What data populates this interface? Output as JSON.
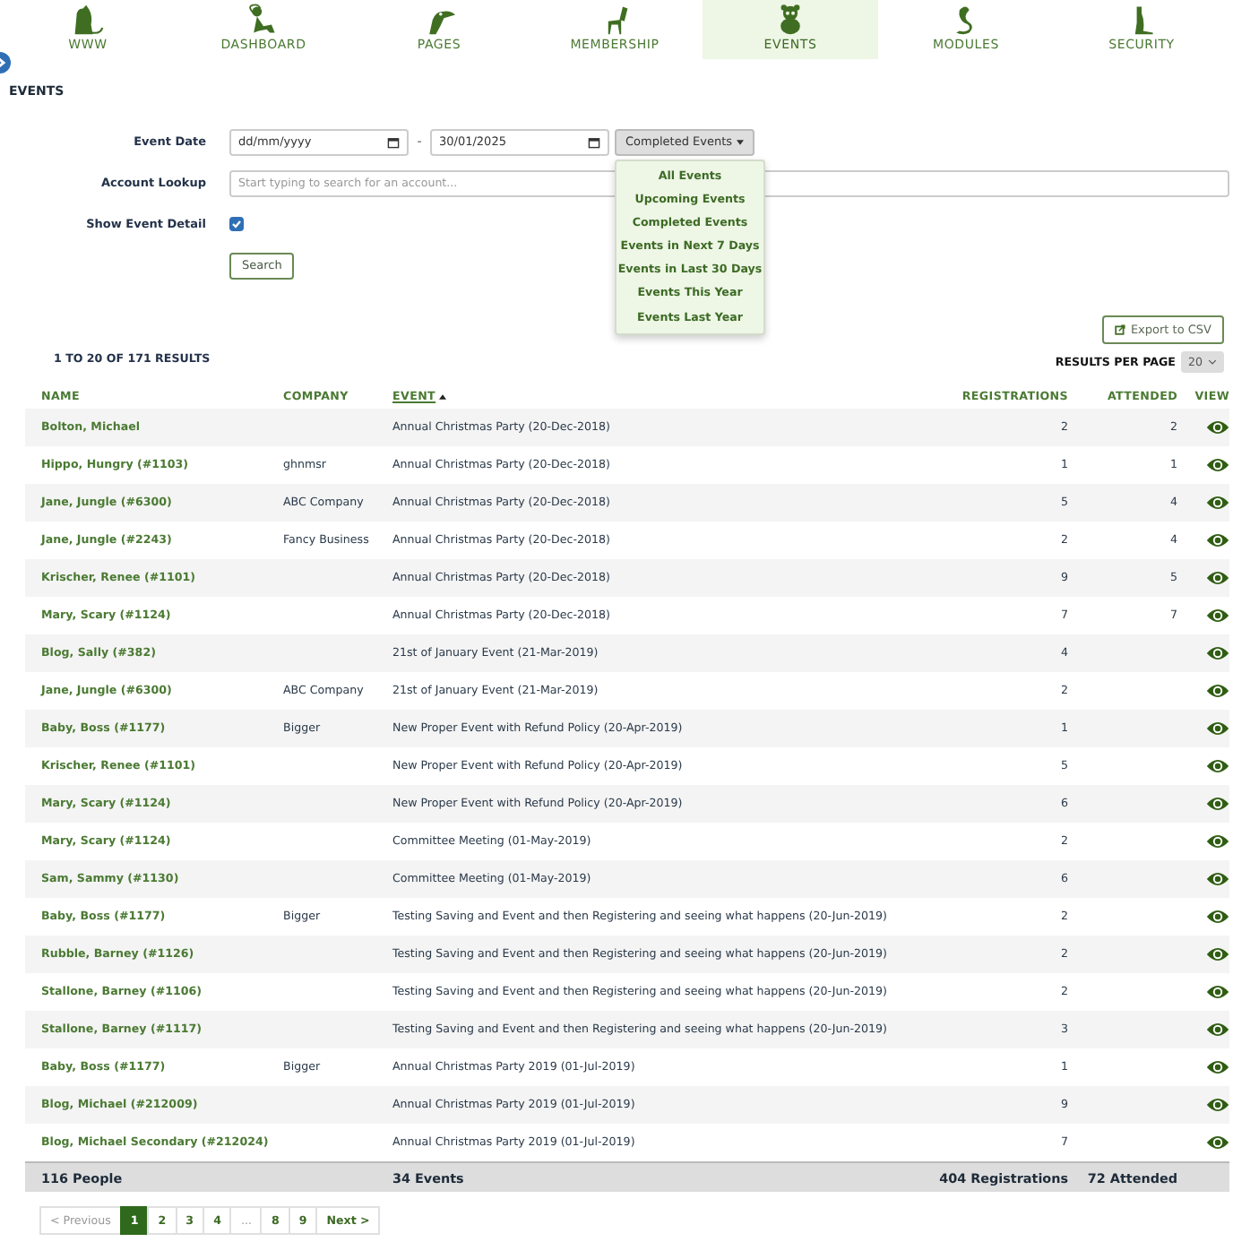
{
  "nav": [
    {
      "label": "WWW",
      "selected": false
    },
    {
      "label": "DASHBOARD",
      "selected": false
    },
    {
      "label": "PAGES",
      "selected": false
    },
    {
      "label": "MEMBERSHIP",
      "selected": false
    },
    {
      "label": "EVENTS",
      "selected": true
    },
    {
      "label": "MODULES",
      "selected": false
    },
    {
      "label": "SECURITY",
      "selected": false
    }
  ],
  "page_title": "EVENTS",
  "filters": {
    "event_date": {
      "label": "Event Date",
      "from": {
        "placeholder": "dd/mm/yyyy"
      },
      "separator": "-",
      "to": {
        "value": "30/01/2025"
      },
      "range_button": "Completed Events",
      "range_menu": [
        "All Events",
        "Upcoming Events",
        "Completed Events",
        "Events in Next 7 Days",
        "Events in Last 30 Days",
        "Events This Year",
        "Events Last Year"
      ]
    },
    "account_lookup": {
      "label": "Account Lookup",
      "placeholder": "Start typing to search for an account..."
    },
    "show_event_detail": {
      "label": "Show Event Detail",
      "checked": true
    },
    "search_button": "Search"
  },
  "results_summary": "1 TO 20 OF 171 RESULTS",
  "export_button": "Export to CSV",
  "per_page": {
    "label": "RESULTS PER PAGE",
    "value": "20"
  },
  "table": {
    "columns": [
      {
        "label": "NAME",
        "sorted": false
      },
      {
        "label": "COMPANY",
        "sorted": false
      },
      {
        "label": "EVENT",
        "sorted": true
      },
      {
        "label": "REGISTRATIONS",
        "sorted": false
      },
      {
        "label": "ATTENDED",
        "sorted": false
      },
      {
        "label": "VIEW",
        "sorted": false
      }
    ],
    "rows": [
      {
        "name": "Bolton, Michael",
        "company": "",
        "event": "Annual Christmas Party (20-Dec-2018)",
        "registrations": "2",
        "attended": "2"
      },
      {
        "name": "Hippo, Hungry  (#1103)",
        "company": "ghnmsr",
        "event": "Annual Christmas Party (20-Dec-2018)",
        "registrations": "1",
        "attended": "1"
      },
      {
        "name": "Jane, Jungle  (#6300)",
        "company": "ABC Company",
        "event": "Annual Christmas Party (20-Dec-2018)",
        "registrations": "5",
        "attended": "4"
      },
      {
        "name": "Jane, Jungle  (#2243)",
        "company": "Fancy Business",
        "event": "Annual Christmas Party (20-Dec-2018)",
        "registrations": "2",
        "attended": "4"
      },
      {
        "name": "Krischer, Renee  (#1101)",
        "company": "",
        "event": "Annual Christmas Party (20-Dec-2018)",
        "registrations": "9",
        "attended": "5"
      },
      {
        "name": "Mary, Scary  (#1124)",
        "company": "",
        "event": "Annual Christmas Party (20-Dec-2018)",
        "registrations": "7",
        "attended": "7"
      },
      {
        "name": "Blog, Sally  (#382)",
        "company": "",
        "event": "21st of January Event (21-Mar-2019)",
        "registrations": "4",
        "attended": ""
      },
      {
        "name": "Jane, Jungle  (#6300)",
        "company": "ABC Company",
        "event": "21st of January Event (21-Mar-2019)",
        "registrations": "2",
        "attended": ""
      },
      {
        "name": "Baby, Boss  (#1177)",
        "company": "Bigger",
        "event": "New Proper Event with Refund Policy (20-Apr-2019)",
        "registrations": "1",
        "attended": ""
      },
      {
        "name": "Krischer, Renee  (#1101)",
        "company": "",
        "event": "New Proper Event with Refund Policy (20-Apr-2019)",
        "registrations": "5",
        "attended": ""
      },
      {
        "name": "Mary, Scary  (#1124)",
        "company": "",
        "event": "New Proper Event with Refund Policy (20-Apr-2019)",
        "registrations": "6",
        "attended": ""
      },
      {
        "name": "Mary, Scary  (#1124)",
        "company": "",
        "event": "Committee Meeting (01-May-2019)",
        "registrations": "2",
        "attended": ""
      },
      {
        "name": "Sam, Sammy  (#1130)",
        "company": "",
        "event": "Committee Meeting (01-May-2019)",
        "registrations": "6",
        "attended": ""
      },
      {
        "name": "Baby, Boss  (#1177)",
        "company": "Bigger",
        "event": "Testing Saving and Event and then Registering and seeing what happens (20-Jun-2019)",
        "registrations": "2",
        "attended": ""
      },
      {
        "name": "Rubble, Barney  (#1126)",
        "company": "",
        "event": "Testing Saving and Event and then Registering and seeing what happens (20-Jun-2019)",
        "registrations": "2",
        "attended": ""
      },
      {
        "name": "Stallone, Barney  (#1106)",
        "company": "",
        "event": "Testing Saving and Event and then Registering and seeing what happens (20-Jun-2019)",
        "registrations": "2",
        "attended": ""
      },
      {
        "name": "Stallone, Barney  (#1117)",
        "company": "",
        "event": "Testing Saving and Event and then Registering and seeing what happens (20-Jun-2019)",
        "registrations": "3",
        "attended": ""
      },
      {
        "name": "Baby, Boss  (#1177)",
        "company": "Bigger",
        "event": "Annual Christmas Party 2019 (01-Jul-2019)",
        "registrations": "1",
        "attended": ""
      },
      {
        "name": "Blog, Michael  (#212009)",
        "company": "",
        "event": "Annual Christmas Party 2019 (01-Jul-2019)",
        "registrations": "9",
        "attended": ""
      },
      {
        "name": "Blog, Michael Secondary  (#212024)",
        "company": "",
        "event": "Annual Christmas Party 2019 (01-Jul-2019)",
        "registrations": "7",
        "attended": ""
      }
    ],
    "totals": {
      "people": "116 People",
      "events": "34 Events",
      "registrations": "404 Registrations",
      "attended": "72 Attended"
    }
  },
  "pagination": [
    {
      "label": "< Previous",
      "selected": false,
      "disabled": true
    },
    {
      "label": "1",
      "selected": true,
      "disabled": false
    },
    {
      "label": "2",
      "selected": false,
      "disabled": false
    },
    {
      "label": "3",
      "selected": false,
      "disabled": false
    },
    {
      "label": "4",
      "selected": false,
      "disabled": false
    },
    {
      "label": "...",
      "selected": false,
      "disabled": true
    },
    {
      "label": "8",
      "selected": false,
      "disabled": false
    },
    {
      "label": "9",
      "selected": false,
      "disabled": false
    },
    {
      "label": "Next >",
      "selected": false,
      "disabled": false
    }
  ]
}
